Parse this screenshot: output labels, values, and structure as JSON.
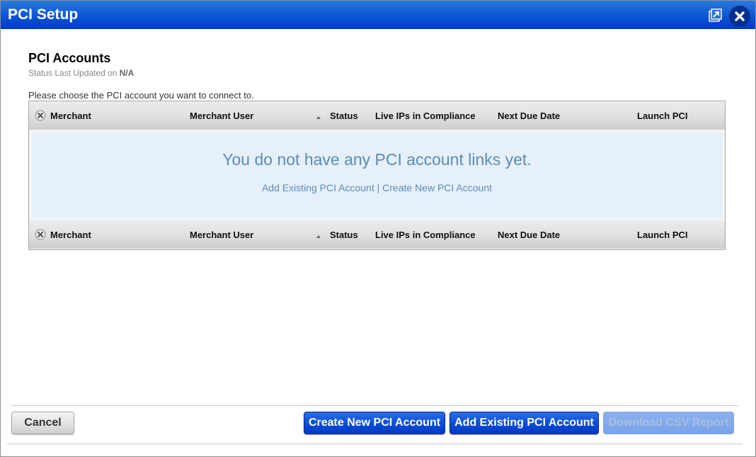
{
  "window": {
    "title": "PCI Setup",
    "icons": {
      "popout": "popout-icon",
      "close": "close-icon"
    },
    "accent_color": "#0f59d4"
  },
  "header": {
    "section_title": "PCI Accounts",
    "status_prefix": "Status Last Updated on",
    "status_value": "N/A",
    "instructions": "Please choose the PCI account you want to connect to."
  },
  "grid": {
    "clear_icon": "clear-filter-icon",
    "sort_icon": "sort-ascending-icon",
    "columns": [
      {
        "key": "merchant",
        "label": "Merchant"
      },
      {
        "key": "merchant_user",
        "label": "Merchant User"
      },
      {
        "key": "status",
        "label": "Status"
      },
      {
        "key": "live_ips",
        "label": "Live IPs in Compliance"
      },
      {
        "key": "next_due",
        "label": "Next Due Date"
      },
      {
        "key": "launch",
        "label": "Launch PCI"
      }
    ],
    "rows": [],
    "empty_message": "You do not have any PCI account links yet.",
    "empty_links": {
      "add_existing": "Add Existing PCI Account",
      "separator": "|",
      "create_new": "Create New PCI Account"
    }
  },
  "footer": {
    "cancel": "Cancel",
    "create_new": "Create New PCI Account",
    "add_existing": "Add Existing PCI Account",
    "download_csv": "Download CSV Report",
    "download_csv_enabled": false
  }
}
